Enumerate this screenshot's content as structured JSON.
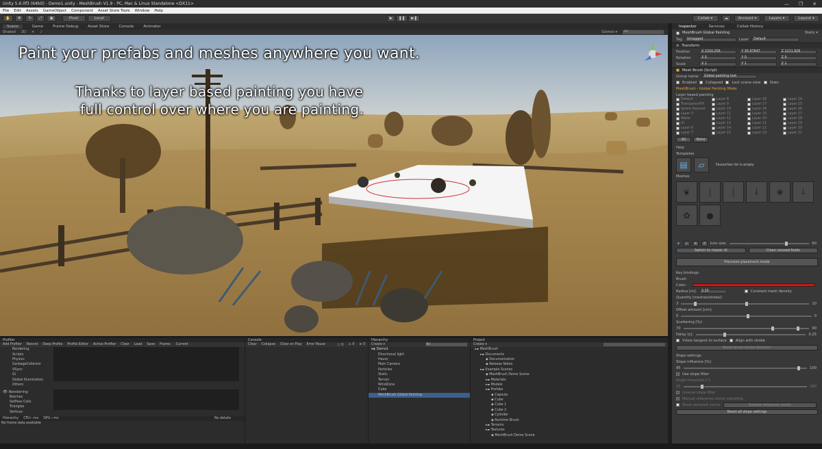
{
  "window": {
    "title": "Unity 5.6.0f3 (64bit) - Demo1.unity - MeshBrush V1.9 - PC, Mac & Linux Standalone <DX11>"
  },
  "menu": [
    "File",
    "Edit",
    "Assets",
    "GameObject",
    "Component",
    "Asset Store Tools",
    "Window",
    "Help"
  ],
  "toolbar": {
    "pivot": "Pivot",
    "local": "Local",
    "collab": "Collab ▾",
    "account": "Account ▾",
    "layers": "Layers ▾",
    "layout": "Layout ▾"
  },
  "scene_tabs": [
    "Scene",
    "Game",
    "Frame Debug",
    "Asset Store",
    "Console",
    "Animator"
  ],
  "scene_bar": {
    "shaded": "Shaded",
    "mode": "2D",
    "gizmos": "Gizmos ▾",
    "search": "All"
  },
  "captions": {
    "line1": "Paint your prefabs and meshes anywhere you want.",
    "line2": "Thanks to layer based painting you have",
    "line3": "full control over where you are painting."
  },
  "inspector": {
    "tabs": [
      "Inspector",
      "Services",
      "Collab History"
    ],
    "object_name": "MeshBrush Global Painting",
    "static": "Static ▾",
    "tag_label": "Tag",
    "tag": "Untagged",
    "layer_label": "Layer",
    "layer": "Default",
    "transform": "Transform",
    "position": {
      "label": "Position",
      "x": "X 1310.256",
      "y": "Y 35.97647",
      "z": "Z 1211.926"
    },
    "rotation": {
      "label": "Rotation",
      "x": "X 0",
      "y": "Y 0",
      "z": "Z 0"
    },
    "scale": {
      "label": "Scale",
      "x": "X 1",
      "y": "Y 1",
      "z": "Z 1"
    },
    "script": "Mesh Brush (Script)",
    "group_name_label": "Group name:",
    "group_name": "Global painting test",
    "flags": [
      "Enabled",
      "Collapsed",
      "Lock scene view",
      "Stats"
    ],
    "mode_title": "MeshBrush - Global Painting Mode",
    "layer_title": "Layer based painting",
    "layers": [
      "Default",
      "TransparentFX",
      "Ignore Raycast",
      "Layer 3",
      "Water",
      "UI",
      "Layer 6",
      "Layer 7",
      "Layer 8",
      "Layer 9",
      "Layer 10",
      "Layer 11",
      "Layer 12",
      "Layer 13",
      "Layer 14",
      "Layer 15",
      "Layer 16",
      "Layer 17",
      "Layer 18",
      "Layer 19",
      "Layer 20",
      "Layer 21",
      "Layer 22",
      "Layer 23",
      "Layer 24",
      "Layer 25",
      "Layer 26",
      "Layer 27",
      "Layer 28",
      "Layer 29",
      "Layer 30",
      "Layer 31"
    ],
    "all_btn": "All",
    "none_btn": "None",
    "help": "Help",
    "templates": "Templates",
    "favourites": "Favourites list is empty",
    "meshes": "Meshes",
    "icon_size": "Icon size:",
    "icon_size_value": "60",
    "switch_btn": "Switch to classic UI",
    "clean_btn": "Clean unused fields",
    "precision_btn": "Precision placement mode",
    "key_bindings": "Key bindings",
    "brush": "Brush",
    "color": "Color:",
    "radius_label": "Radius [m]:",
    "radius": "3.33",
    "constant_density": "Constant mesh density",
    "quantity": "Quantity [meshes/stroke]:",
    "quantity_min": "3",
    "quantity_max": "10",
    "offset": "Offset amount [cm]:",
    "offset_min": "0",
    "offset_max": "0",
    "scattering": "Scattering [%]:",
    "scattering_min": "70",
    "scattering_max": "90",
    "delay": "Delay [s]:",
    "delay_value": "0.25",
    "yaxis": "Y-Axis tangent to surface",
    "align_stroke": "Align with stroke",
    "paint_dir_btn": "Reset brush stroke direction",
    "slope": "Slope settings",
    "slope_influence": "Slope influence [%]:",
    "slope_min": "95",
    "slope_max": "100",
    "use_filter": "Use slope filter",
    "angle_threshold": "Angle threshold [°]:",
    "angle_min": "25",
    "angle_max": "180",
    "inverse": "Inverse slope filter",
    "manual": "Manual reference vector sampling",
    "show_vector": "Show sampled vector",
    "sample_btn": "Sample reference vector",
    "reset_slope": "Reset all slope settings"
  },
  "profiler": {
    "title": "Profiler",
    "add": "Add Profiler",
    "buttons": [
      "Record",
      "Deep Profile",
      "Profile Editor",
      "Active Profiler",
      "Clear",
      "Load",
      "Save",
      "Frame:",
      "Current"
    ],
    "cpu_items": [
      "Rendering",
      "Scripts",
      "Physics",
      "GarbageCollector",
      "VSync",
      "Gi",
      "Global Illumination",
      "Others"
    ],
    "rendering": "Rendering",
    "rendering_items": [
      "Batches",
      "SetPass Calls",
      "Triangles",
      "Vertices"
    ],
    "hierarchy": "Hierarchy",
    "cpu": "CPU:--ms",
    "gpu": "GPU:--ms",
    "details": "No details",
    "empty": "No frame data available"
  },
  "console": {
    "title": "Console",
    "buttons": [
      "Clear",
      "Collapse",
      "Clear on Play",
      "Error Pause"
    ],
    "counts": [
      "0",
      "0",
      "0"
    ]
  },
  "hierarchy": {
    "title": "Hierarchy",
    "create": "Create ▾",
    "search": "All",
    "scene": "Demo1",
    "items": [
      "Directional light",
      "Havoc",
      "Main Camera",
      "Particles",
      "Static",
      "Terrain",
      "WindZone",
      "Cube",
      "MeshBrush Global Painting"
    ]
  },
  "project": {
    "title": "Project",
    "create": "Create ▾",
    "items": [
      "MeshBrush",
      "Documents",
      "Documentation",
      "Release Notes",
      "Example Scenes",
      "MeshBrush Demo Scene",
      "Materials",
      "Models",
      "Prefabs",
      "Capsule",
      "Cube",
      "Cube 1",
      "Cube 2",
      "Cylinder",
      "Runtime Brush",
      "Terrains",
      "Textures",
      "MeshBrush Demo Scene"
    ]
  },
  "colors": {
    "brush": "#d41414",
    "accent": "#f0a030",
    "selection": "#3d5f8c"
  }
}
